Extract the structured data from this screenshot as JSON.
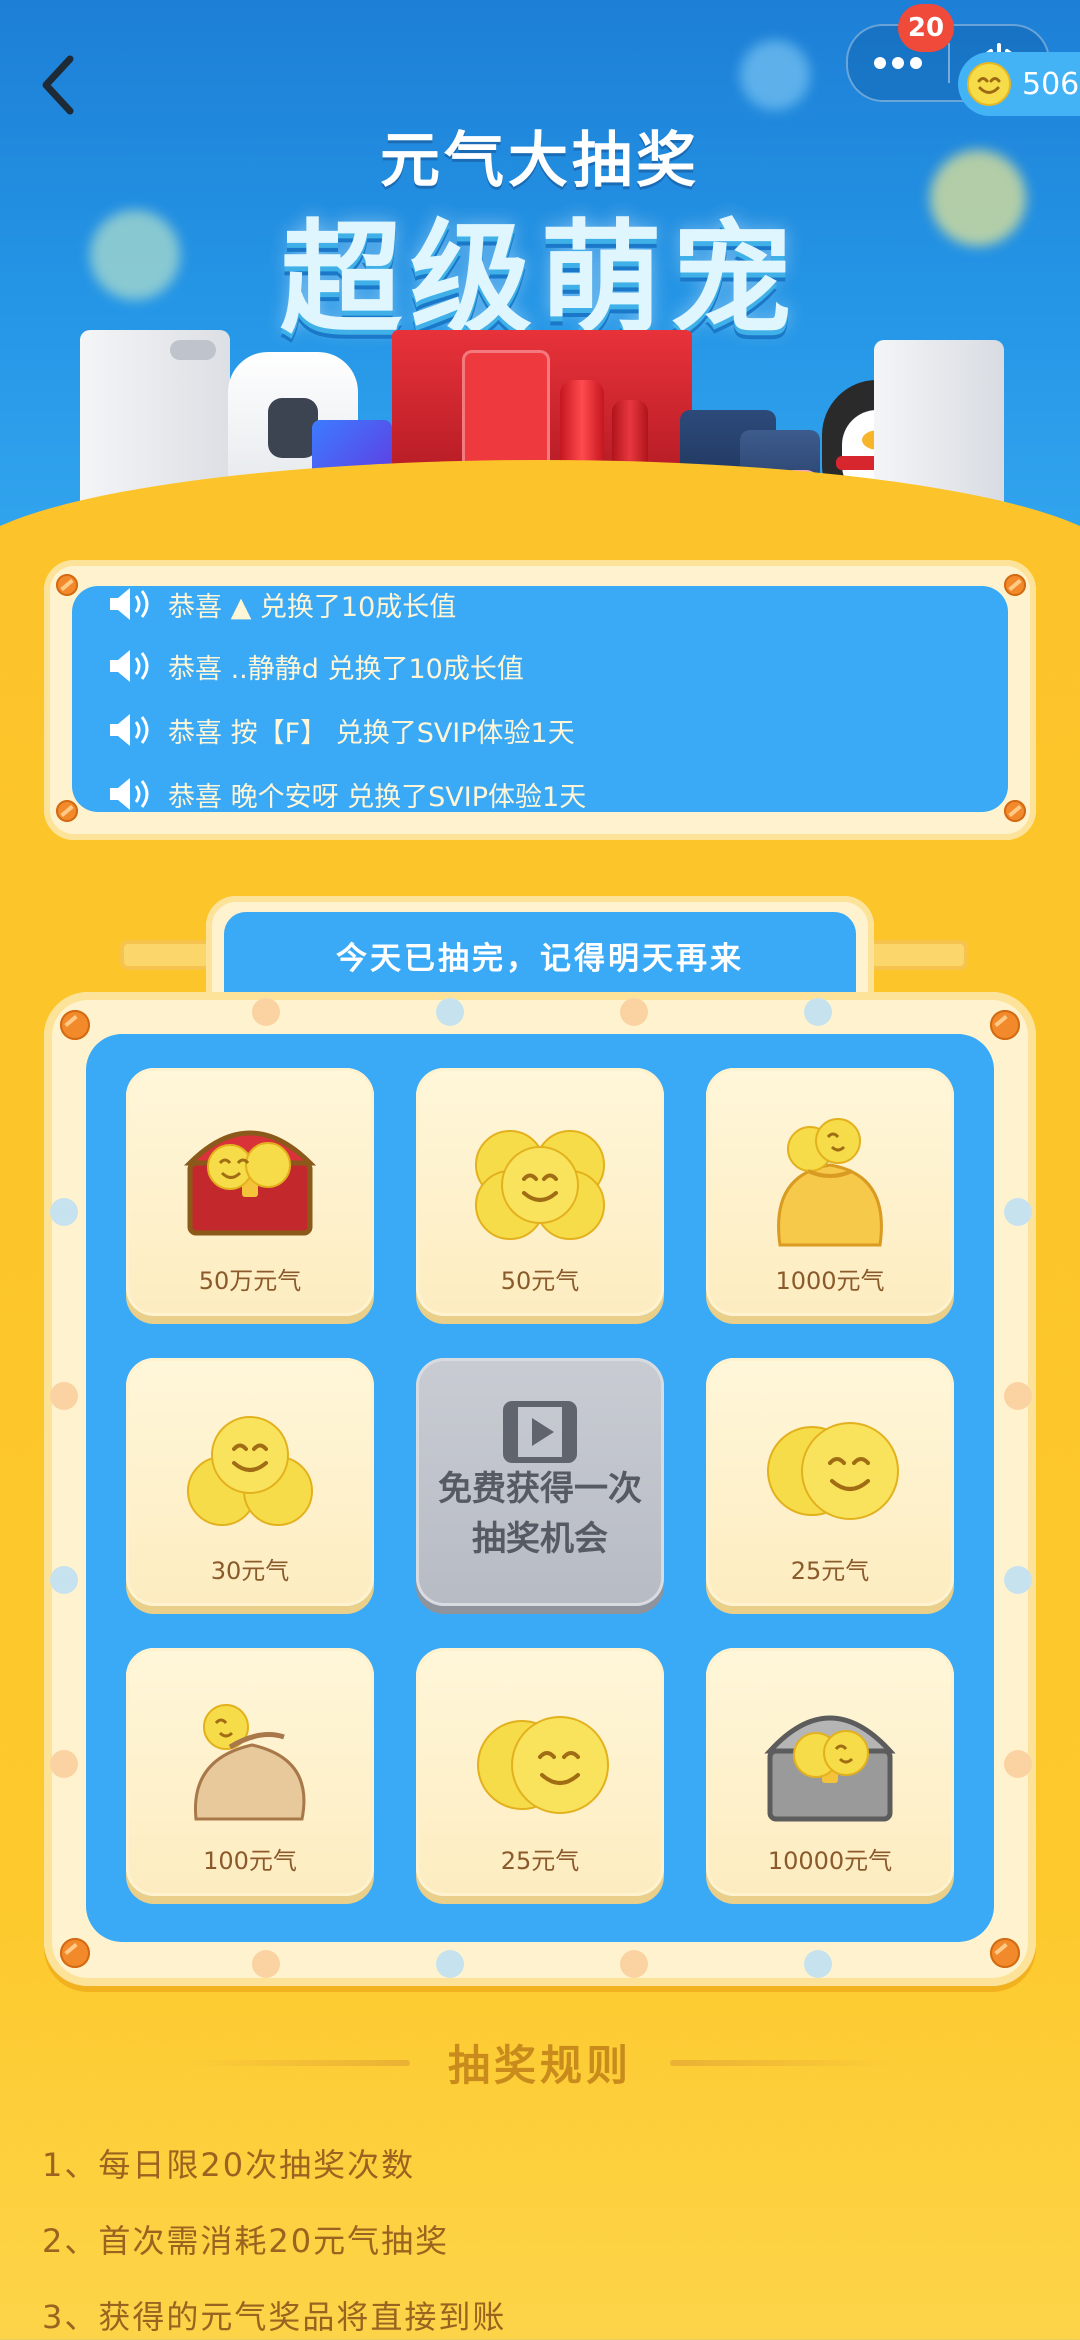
{
  "nav": {
    "notification_count": "20",
    "coin_balance": "506"
  },
  "hero": {
    "title_small": "元气大抽奖",
    "title_big": "超级萌宠"
  },
  "ticker": [
    {
      "text": "恭喜 ▲ 兑换了10成长值"
    },
    {
      "text": "恭喜 ..静静d 兑换了10成长值"
    },
    {
      "text": "恭喜 按【F】 兑换了SVIP体验1天"
    },
    {
      "text": "恭喜 晚个安呀 兑换了SVIP体验1天"
    }
  ],
  "lottery": {
    "status": "今天已抽完，记得明天再来",
    "prizes": [
      {
        "label": "50万元气",
        "icon": "treasure-chest-red-icon"
      },
      {
        "label": "50元气",
        "icon": "coin-cluster-icon"
      },
      {
        "label": "1000元气",
        "icon": "coin-sack-yellow-icon"
      },
      {
        "label": "30元气",
        "icon": "coin-pile-icon"
      },
      {
        "label": "25元气",
        "icon": "two-coins-icon"
      },
      {
        "label": "100元气",
        "icon": "coin-sack-tan-icon"
      },
      {
        "label": "25元气",
        "icon": "two-coins-icon"
      },
      {
        "label": "10000元气",
        "icon": "treasure-chest-gray-icon"
      }
    ],
    "free_chance": "免费获得一次抽奖机会",
    "free_chance_icon": "video-play-icon"
  },
  "rules": {
    "title": "抽奖规则",
    "items": [
      "1、每日限20次抽奖次数",
      "2、首次需消耗20元气抽奖",
      "3、获得的元气奖品将直接到账"
    ]
  },
  "colors": {
    "sky_blue": "#2596e6",
    "board_blue": "#3aa9f6",
    "page_yellow": "#fcc42a",
    "frame_cream": "#fff3cf",
    "badge_red": "#f04a3a"
  }
}
